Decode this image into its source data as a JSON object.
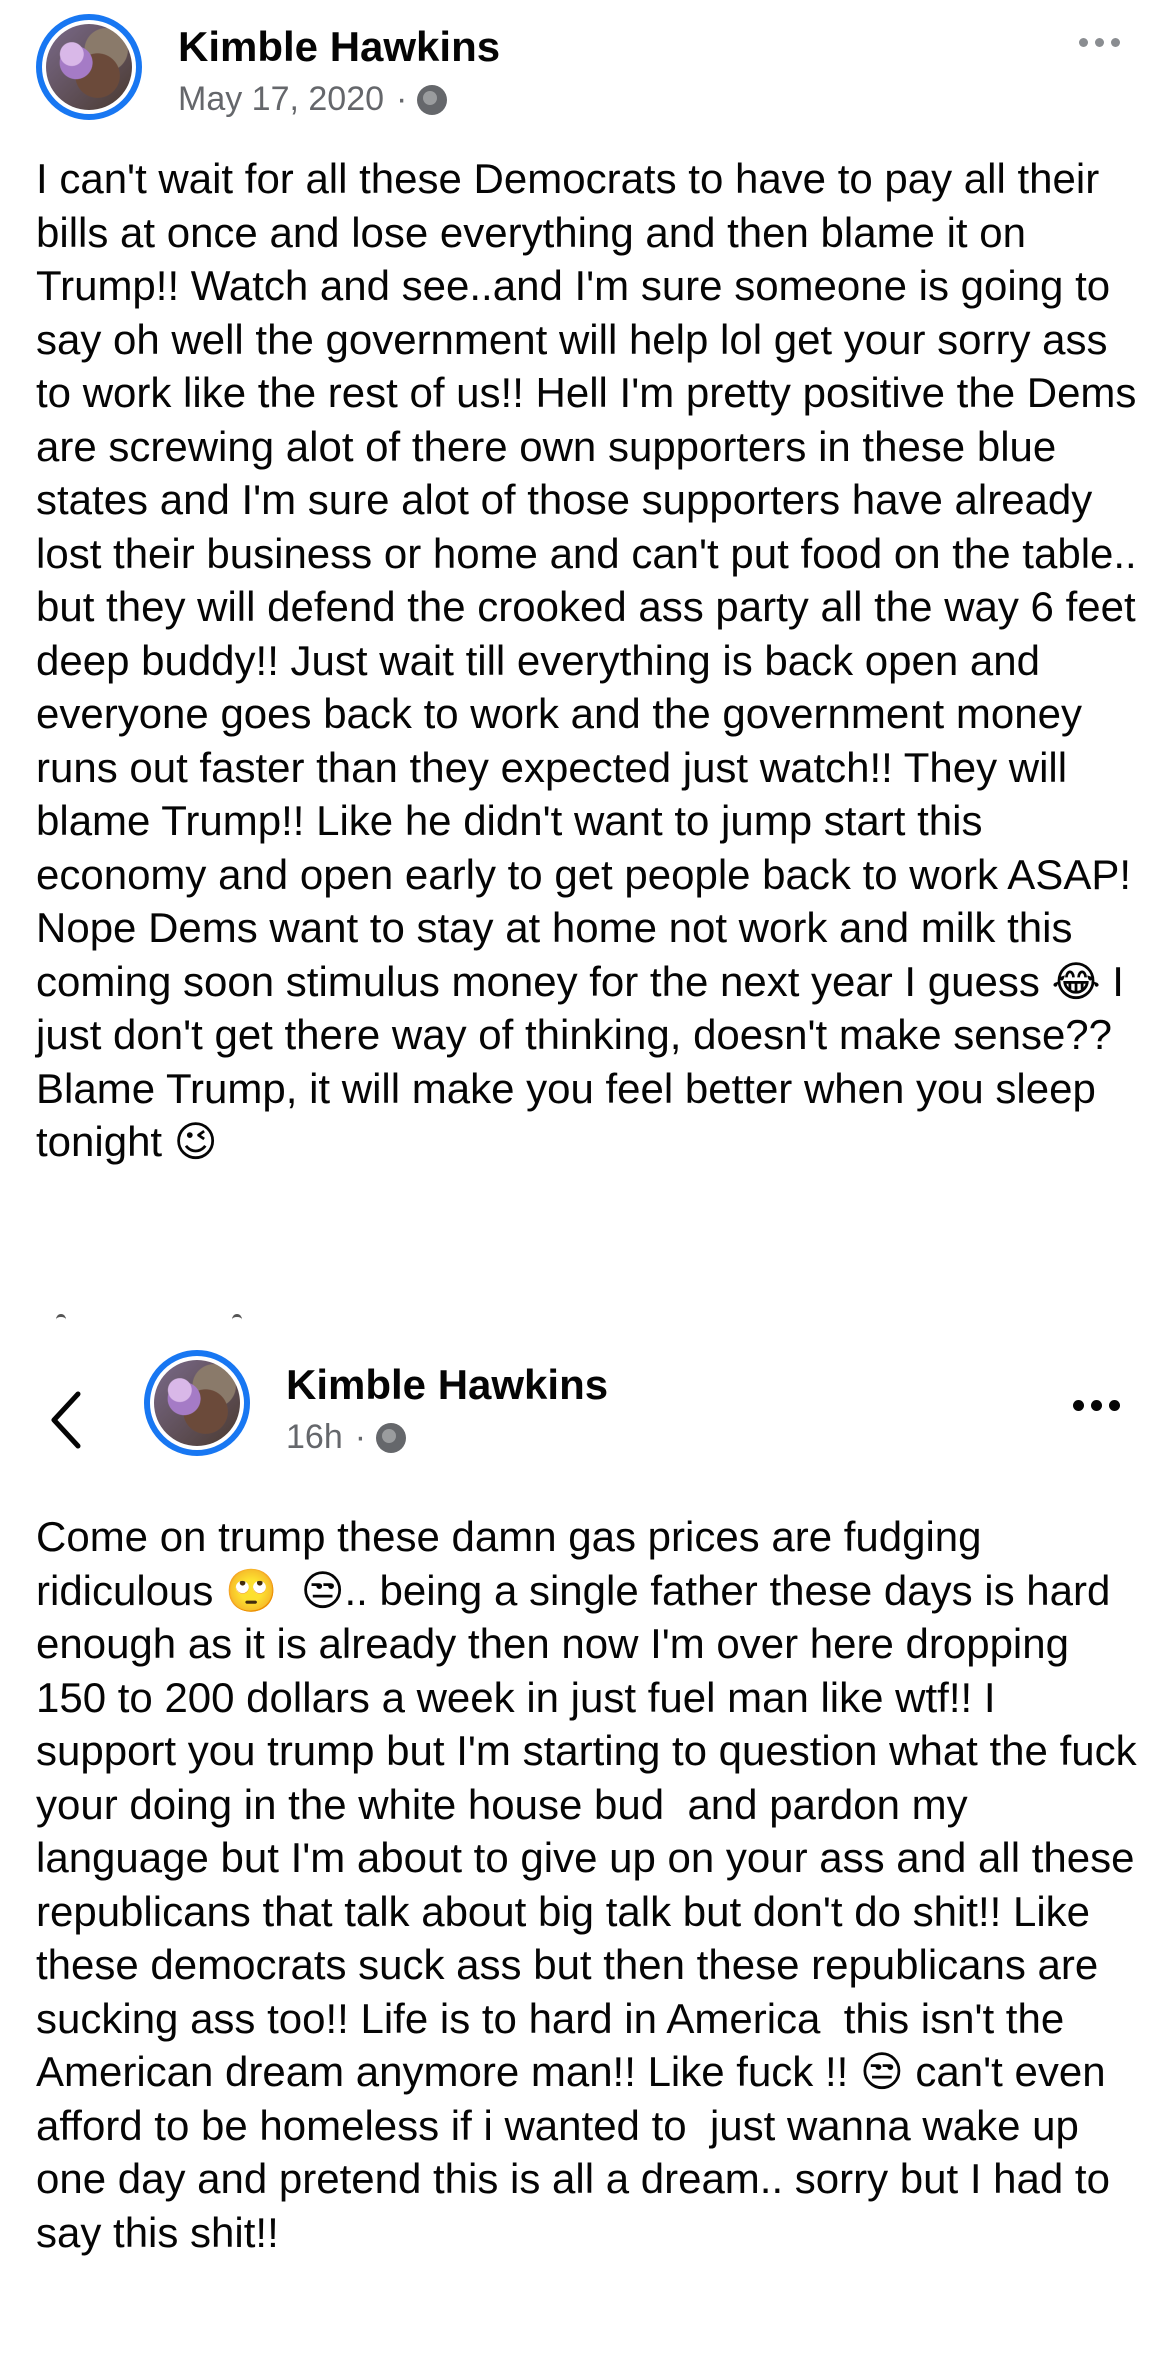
{
  "posts": [
    {
      "author": "Kimble Hawkins",
      "timestamp": "May 17, 2020",
      "separator": "·",
      "privacy_icon": "globe-icon",
      "more_icon": "more-options-icon",
      "text": "I can't wait for all these Democrats to have to pay all their bills at once and lose everything and then blame it on Trump!! Watch and see..and I'm sure someone is going to say oh well the government will help lol get your sorry ass to work like the rest of us!! Hell I'm pretty positive the Dems are screwing alot of there own supporters in these blue states and I'm sure alot of those supporters have already lost their business or home and can't put food on the table.. but they will defend the crooked ass party all the way 6 feet deep buddy!! Just wait till everything is back open and everyone goes back to work and the government money runs out faster than they expected just watch!! They will blame Trump!! Like he didn't want to jump start this economy and open early to get people back to work ASAP! Nope Dems want to stay at home not work and milk this coming soon stimulus money for the next year I guess 😂 I just don't get there way of thinking, doesn't make sense?? Blame Trump, it will make you feel better when you sleep tonight 😉"
    },
    {
      "author": "Kimble Hawkins",
      "timestamp": "16h",
      "separator": "·",
      "privacy_icon": "globe-icon",
      "back_icon": "back-chevron-icon",
      "more_icon": "more-options-icon",
      "text": "Come on trump these damn gas prices are fudging ridiculous 🙄  😒.. being a single father these days is hard enough as it is already then now I'm over here dropping  150 to 200 dollars a week in just fuel man like wtf!! I support you trump but I'm starting to question what the fuck your doing in the white house bud  and pardon my language but I'm about to give up on your ass and all these republicans that talk about big talk but don't do shit!! Like these democrats suck ass but then these republicans are sucking ass too!! Life is to hard in America  this isn't the American dream anymore man!! Like fuck !! 😒 can't even afford to be homeless if i wanted to  just wanna wake up one day and pretend this is all a dream.. sorry but I had to say this shit!!"
    }
  ],
  "colors": {
    "avatar_ring": "#1877f2",
    "text_primary": "#050505",
    "text_secondary": "#65676b"
  }
}
